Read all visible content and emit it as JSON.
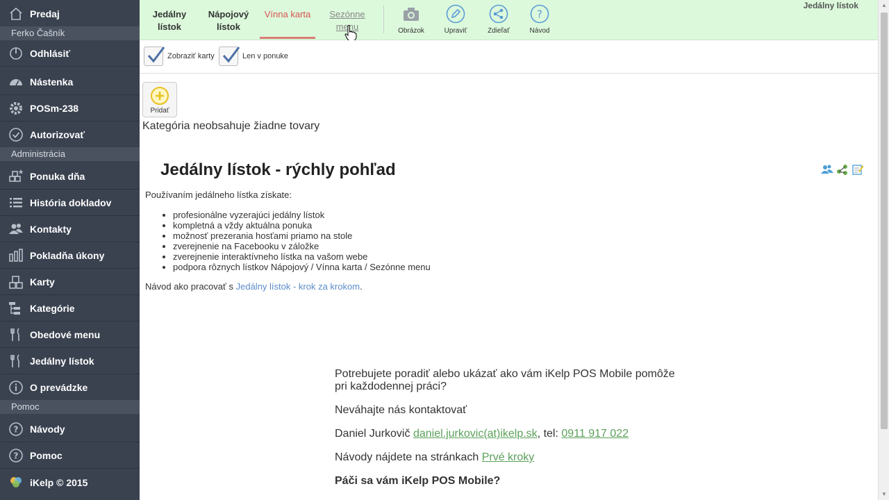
{
  "sidebar": {
    "sale": "Predaj",
    "user": "Ferko Čašník",
    "logout": "Odhlásiť",
    "dashboard": "Nástenka",
    "device": "POSm-238",
    "authorize": "Autorizovať",
    "admin_header": "Administrácia",
    "daily_offer": "Ponuka dňa",
    "doc_history": "História dokladov",
    "contacts": "Kontakty",
    "cash_ops": "Pokladňa úkony",
    "cards": "Karty",
    "categories": "Kategórie",
    "lunch_menu": "Obedové menu",
    "food_menu": "Jedálny lístok",
    "about_venue": "O prevádzke",
    "help_header": "Pomoc",
    "guides": "Návody",
    "help": "Pomoc",
    "copyright": "iKelp © 2015"
  },
  "toolbar": {
    "tabs": [
      "Jedálny lístok",
      "Nápojový lístok",
      "Vínna karta",
      "Sezónne menu"
    ],
    "picture": "Obrázok",
    "edit": "Upraviť",
    "share": "Zdieľať",
    "guide": "Návod",
    "page_title": "Jedálny lístok"
  },
  "filters": {
    "show_cards": "Zobraziť karty",
    "only_in_offer": "Len v ponuke"
  },
  "main": {
    "add": "Pridať",
    "empty": "Kategória neobsahuje žiadne tovary",
    "heading": "Jedálny lístok - rýchly pohľad",
    "intro": "Používaním jedálneho lístka získate:",
    "benefits": [
      "profesionálne vyzerajúci jedálny lístok",
      "kompletná a vždy aktuálna ponuka",
      "možnosť prezerania hosťami priamo na stole",
      "zverejnenie na Facebooku v záložke",
      "zverejnenie interaktívneho lístka na vašom webe",
      "podpora rôznych lístkov Nápojový / Vínna karta / Sezónne menu"
    ],
    "guide_prefix": "Návod ako pracovať s ",
    "guide_link": "Jedálny lístok - krok za krokom",
    "guide_suffix": "."
  },
  "contact": {
    "line1": "Potrebujete poradiť alebo ukázať ako vám iKelp POS Mobile pomôže pri každodennej práci?",
    "line2": "Neváhajte nás kontaktovať",
    "name": "Daniel Jurkovič ",
    "email": "daniel.jurkovic(at)ikelp.sk",
    "tel_prefix": ", tel: ",
    "tel": "0911 917 022",
    "guides_prefix": "Návody nájdete na stránkach ",
    "guides_link": "Prvé kroky",
    "question": "Páči sa vám iKelp POS Mobile?"
  },
  "colors": {
    "sidebar_bg": "#3a4250",
    "toolbar_bg": "#dcf9dc",
    "active_tab": "#d9534f",
    "link": "#5b8cc8",
    "contact_link": "#5aa05a"
  }
}
